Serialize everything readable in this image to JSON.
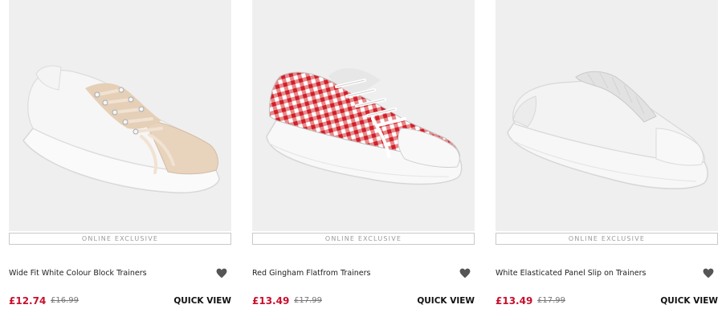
{
  "products": [
    {
      "image_desc": "white-and-nude-lace-up-trainer",
      "badge": "ONLINE EXCLUSIVE",
      "name": "Wide Fit White Colour Block Trainers",
      "price": "£12.74",
      "was_price": "£16.99",
      "quick_view": "QUICK VIEW",
      "icon": "heart-icon"
    },
    {
      "image_desc": "red-gingham-flatform-trainer",
      "badge": "ONLINE EXCLUSIVE",
      "name": "Red Gingham Flatfrom Trainers",
      "price": "£13.49",
      "was_price": "£17.99",
      "quick_view": "QUICK VIEW",
      "icon": "heart-icon"
    },
    {
      "image_desc": "white-elasticated-slip-on-trainer",
      "badge": "ONLINE EXCLUSIVE",
      "name": "White Elasticated Panel Slip on Trainers",
      "price": "£13.49",
      "was_price": "£17.99",
      "quick_view": "QUICK VIEW",
      "icon": "heart-icon"
    }
  ],
  "colors": {
    "price": "#c8102e",
    "image_bg": "#efefef",
    "heart": "#555555"
  }
}
